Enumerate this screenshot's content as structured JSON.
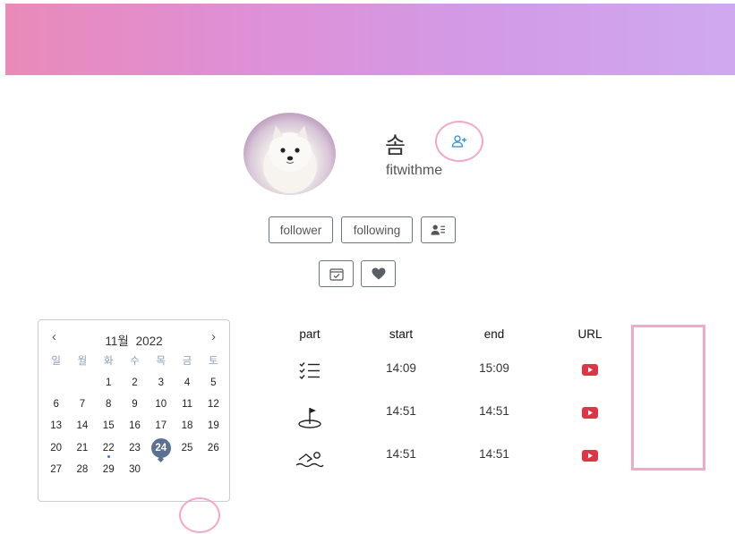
{
  "profile": {
    "name": "솜",
    "handle": "fitwithme",
    "avatar_icon": "dog-avatar",
    "add_friend_icon": "person-plus-icon"
  },
  "buttons": {
    "follower": "follower",
    "following": "following",
    "contact_card_icon": "person-lines-icon",
    "calendar_check_icon": "calendar-check-icon",
    "heart_icon": "heart-icon"
  },
  "calendar": {
    "month_label": "11월",
    "year_label": "2022",
    "prev": "‹",
    "next": "›",
    "weekdays": [
      "일",
      "월",
      "화",
      "수",
      "목",
      "금",
      "토"
    ],
    "weeks": [
      [
        "",
        "",
        "1",
        "2",
        "3",
        "4",
        "5"
      ],
      [
        "6",
        "7",
        "8",
        "9",
        "10",
        "11",
        "12"
      ],
      [
        "13",
        "14",
        "15",
        "16",
        "17",
        "18",
        "19"
      ],
      [
        "20",
        "21",
        "22",
        "23",
        "24",
        "25",
        "26"
      ],
      [
        "27",
        "28",
        "29",
        "30",
        "",
        "",
        ""
      ]
    ],
    "selected_day": "24",
    "marked_day": "22"
  },
  "records": {
    "headers": [
      "part",
      "start",
      "end",
      "URL"
    ],
    "rows": [
      {
        "part_icon": "checklist-icon",
        "start": "14:09",
        "end": "15:09",
        "url_icon": "youtube-icon"
      },
      {
        "part_icon": "golf-icon",
        "start": "14:51",
        "end": "14:51",
        "url_icon": "youtube-icon"
      },
      {
        "part_icon": "swimming-icon",
        "start": "14:51",
        "end": "14:51",
        "url_icon": "youtube-icon"
      }
    ]
  },
  "colors": {
    "accent_pink": "#f3a8c8",
    "selected_day": "#5a7191",
    "youtube_red": "#dc3545",
    "add_friend_blue": "#2f8fdb"
  }
}
